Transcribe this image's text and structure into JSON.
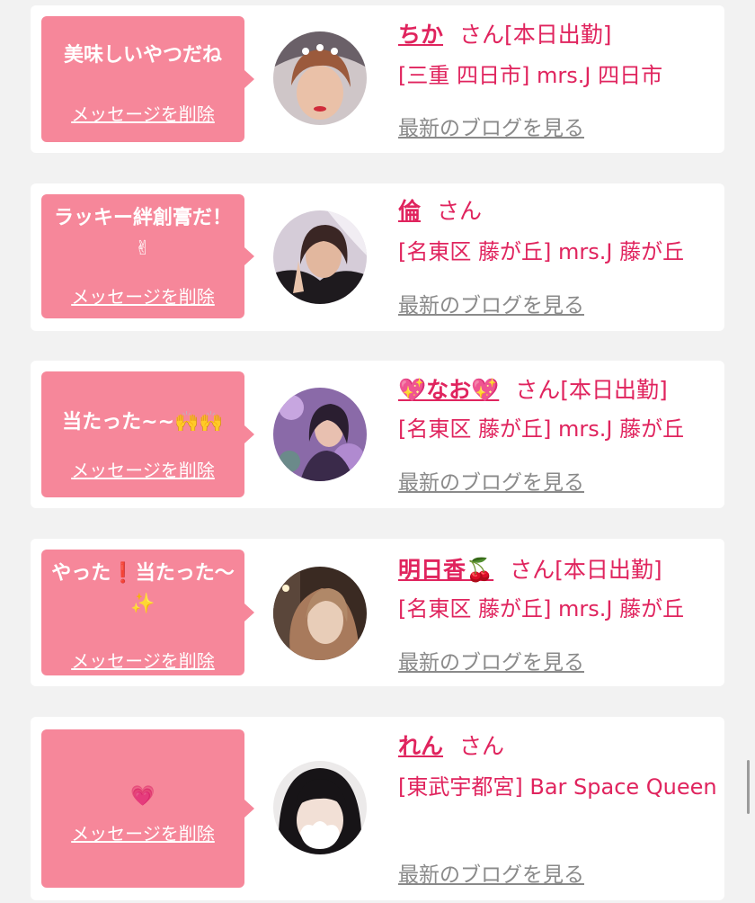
{
  "favorites": [
    {
      "message": "美味しいやつだね",
      "delete_label": "メッセージを削除",
      "name": "ちか",
      "suffix": "さん[本日出勤]",
      "shop": "[三重 四日市] mrs.J 四日市",
      "blog_link": "最新のブログを見る"
    },
    {
      "message": "ラッキー絆創膏だ！✌",
      "delete_label": "メッセージを削除",
      "name": "倫",
      "suffix": "さん",
      "shop": "[名東区 藤が丘] mrs.J 藤が丘",
      "blog_link": "最新のブログを見る"
    },
    {
      "message": "当たった~~🙌🙌",
      "delete_label": "メッセージを削除",
      "name": "💖なお💖",
      "suffix": "さん[本日出勤]",
      "shop": "[名東区 藤が丘] mrs.J 藤が丘",
      "blog_link": "最新のブログを見る"
    },
    {
      "message": "やった❗当たった〜✨",
      "delete_label": "メッセージを削除",
      "name": "明日香🍒",
      "suffix": "さん[本日出勤]",
      "shop": "[名東区 藤が丘] mrs.J 藤が丘",
      "blog_link": "最新のブログを見る"
    },
    {
      "message": "💗",
      "delete_label": "メッセージを削除",
      "name": "れん",
      "suffix": "さん",
      "shop": "[東武宇都宮] Bar Space Queen",
      "blog_link": "最新のブログを見る"
    }
  ],
  "colors": {
    "bubble": "#f6879a",
    "accent": "#e0245e",
    "link_gray": "#8a8a8a",
    "background": "#f2f2f2"
  }
}
